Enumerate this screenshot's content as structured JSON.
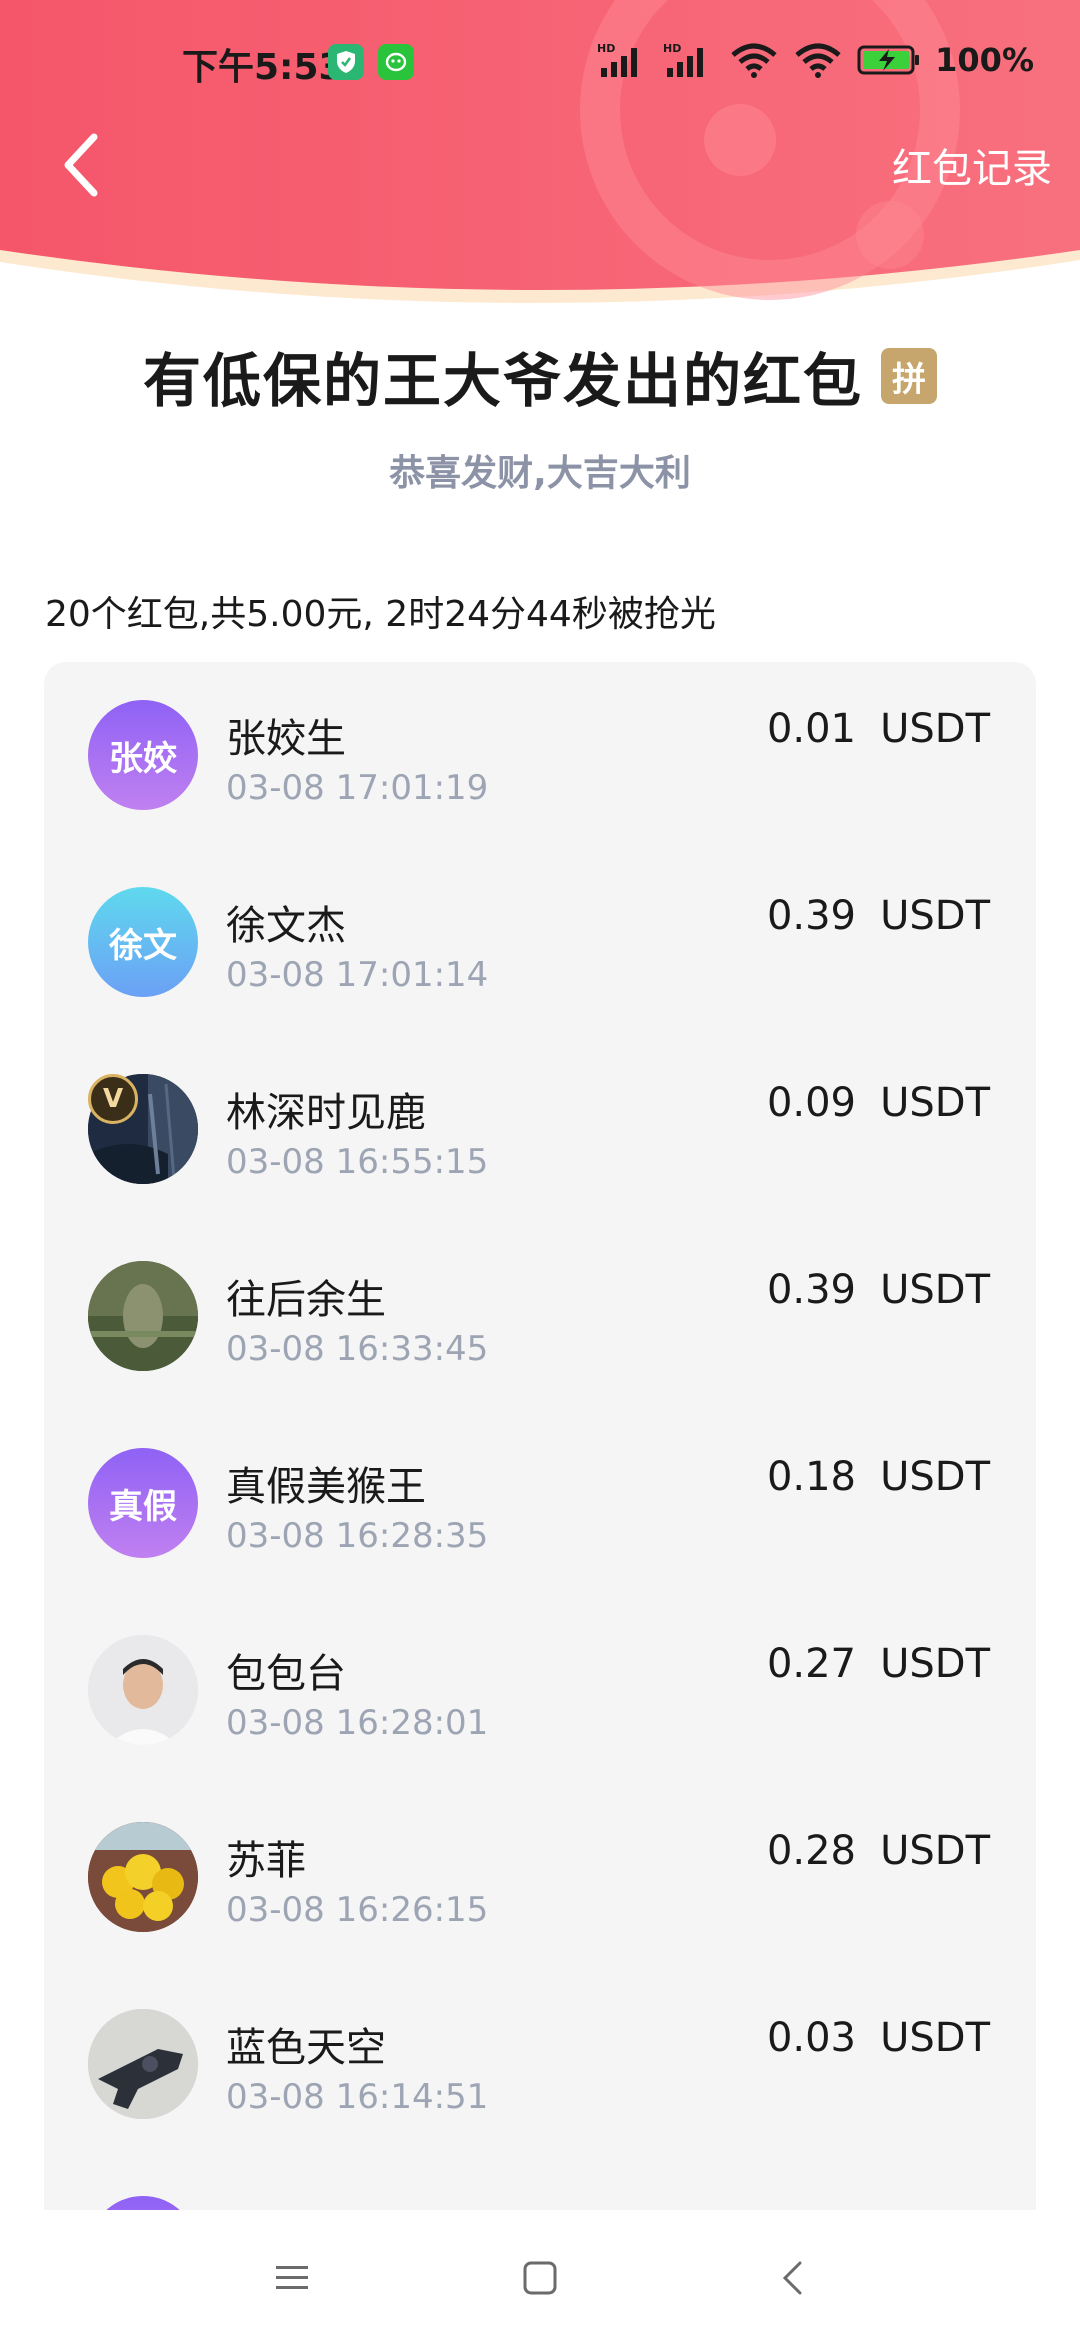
{
  "status_bar": {
    "time": "下午5:53",
    "battery": "100%"
  },
  "header": {
    "records_label": "红包记录"
  },
  "packet": {
    "title": "有低保的王大爷发出的红包",
    "badge": "拼",
    "greeting": "恭喜发财,大吉大利",
    "summary": "20个红包,共5.00元, 2时24分44秒被抢光"
  },
  "records": [
    {
      "name": "张姣生",
      "time": "03-08 17:01:19",
      "amount": "0.01",
      "unit": "USDT",
      "avatar_text": "张姣"
    },
    {
      "name": "徐文杰",
      "time": "03-08 17:01:14",
      "amount": "0.39",
      "unit": "USDT",
      "avatar_text": "徐文"
    },
    {
      "name": "林深时见鹿",
      "time": "03-08 16:55:15",
      "amount": "0.09",
      "unit": "USDT",
      "vip": "V"
    },
    {
      "name": "往后余生",
      "time": "03-08 16:33:45",
      "amount": "0.39",
      "unit": "USDT"
    },
    {
      "name": "真假美猴王",
      "time": "03-08 16:28:35",
      "amount": "0.18",
      "unit": "USDT",
      "avatar_text": "真假"
    },
    {
      "name": "包包台",
      "time": "03-08 16:28:01",
      "amount": "0.27",
      "unit": "USDT"
    },
    {
      "name": "苏菲",
      "time": "03-08 16:26:15",
      "amount": "0.28",
      "unit": "USDT"
    },
    {
      "name": "蓝色天空",
      "time": "03-08 16:14:51",
      "amount": "0.03",
      "unit": "USDT"
    }
  ],
  "colors": {
    "header_red": "#f5566a",
    "header_pink": "#f77d86",
    "badge_gold": "#c7a66e",
    "avatar_purple": "#9b6cf3",
    "avatar_cyan": "#5fc8f0"
  }
}
